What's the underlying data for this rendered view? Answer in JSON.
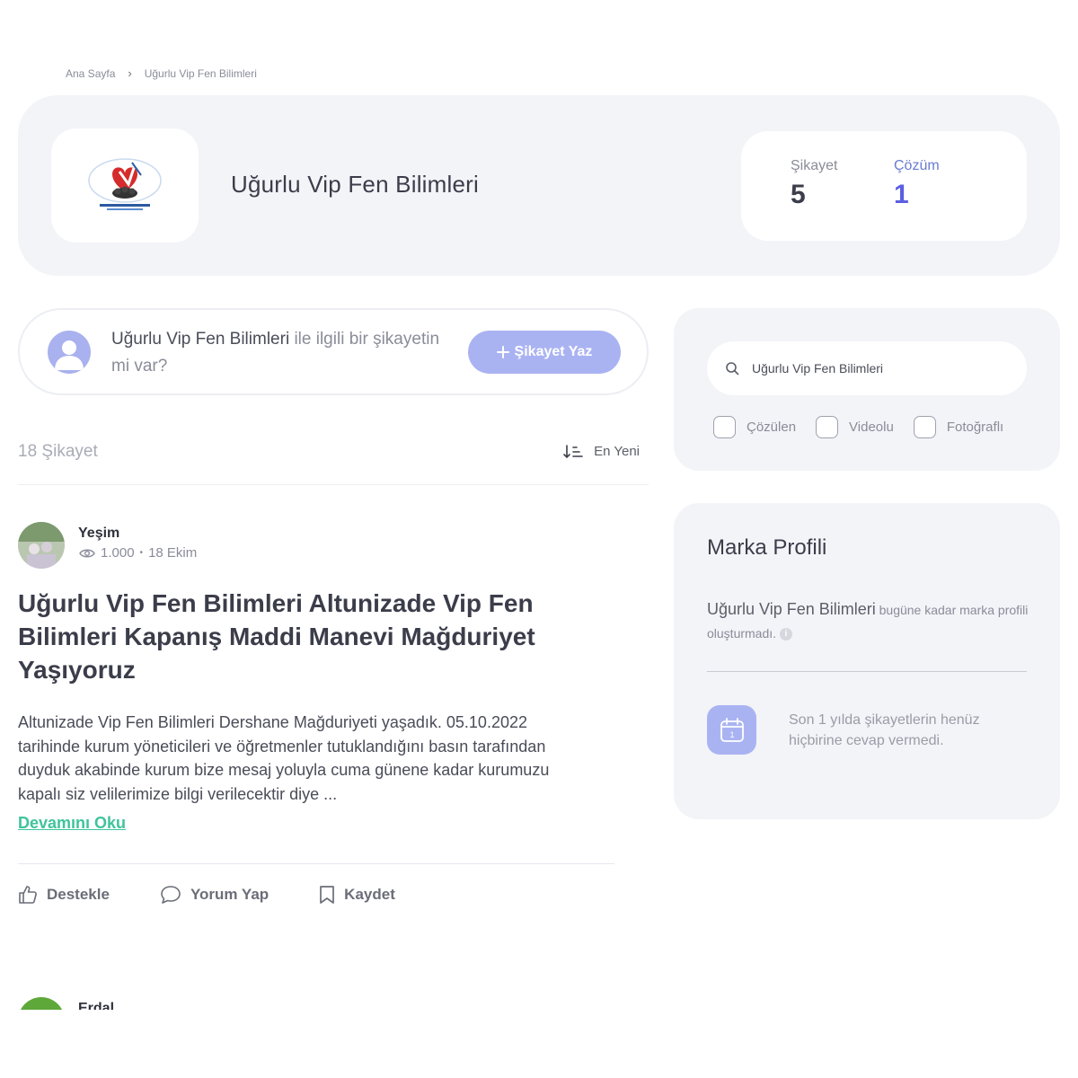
{
  "breadcrumb": {
    "home": "Ana Sayfa",
    "current": "Uğurlu Vip Fen Bilimleri"
  },
  "brand": {
    "name": "Uğurlu Vip Fen Bilimleri",
    "complaint_label": "Şikayet",
    "complaint_count": "5",
    "solution_label": "Çözüm",
    "solution_count": "1"
  },
  "ask": {
    "brand": "Uğurlu Vip Fen Bilimleri",
    "text": " ile ilgili bir şikayetin mi var?",
    "button": "Şikayet Yaz"
  },
  "list": {
    "count": "18",
    "count_label": "Şikayet",
    "sort_label": "En Yeni"
  },
  "post": {
    "author": "Yeşim",
    "views": "1.000",
    "dot": "•",
    "date": "18 Ekim",
    "title": "Uğurlu Vip Fen Bilimleri Altunizade Vip Fen Bilimleri Kapanış Maddi Manevi Mağduriyet Yaşıyoruz",
    "body": "Altunizade Vip Fen Bilimleri Dershane Mağduriyeti yaşadık. 05.10.2022 tarihinde kurum yöneticileri ve öğretmenler tutuklandığını basın tarafından duyduk akabinde kurum bize mesaj yoluyla cuma günene kadar kurumuzu kapalı siz velilerimize bilgi verilecektir diye ...",
    "read_more": "Devamını Oku",
    "actions": {
      "support": "Destekle",
      "comment": "Yorum Yap",
      "save": "Kaydet"
    }
  },
  "next_post": {
    "author": "Erdal"
  },
  "filter": {
    "search_value": "Uğurlu Vip Fen Bilimleri",
    "checks": [
      "Çözülen",
      "Videolu",
      "Fotoğraflı"
    ]
  },
  "profile": {
    "title": "Marka Profili",
    "brand": "Uğurlu Vip Fen Bilimleri",
    "text": " bugüne kadar marka profili oluşturmadı.",
    "info": "i",
    "calendar_day": "1",
    "note": "Son 1 yılda şikayetlerin henüz hiçbirine cevap vermedi."
  },
  "colors": {
    "accent": "#5b5fe0",
    "button": "#aab3f2",
    "link": "#3ec49a",
    "panel": "#f3f4f8"
  },
  "icons": [
    "chevron-right-icon",
    "plus-icon",
    "sort-icon",
    "eye-icon",
    "like-icon",
    "comment-icon",
    "bookmark-icon",
    "search-icon",
    "calendar-icon",
    "user-icon"
  ]
}
